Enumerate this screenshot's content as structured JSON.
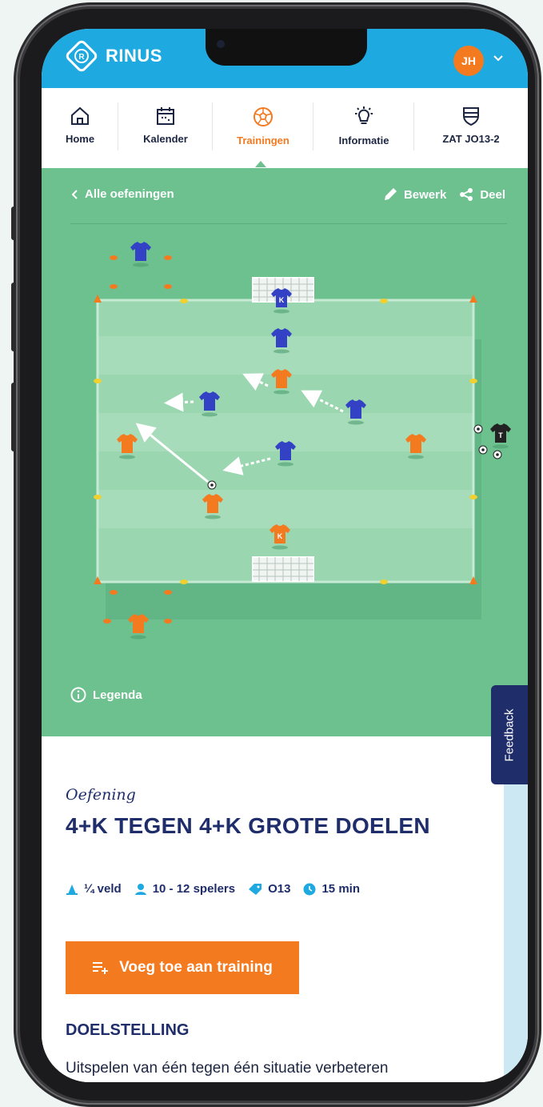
{
  "app": {
    "name": "RINUS",
    "avatar_initials": "JH"
  },
  "nav": {
    "items": [
      {
        "label": "Home",
        "icon": "home-icon"
      },
      {
        "label": "Kalender",
        "icon": "calendar-icon"
      },
      {
        "label": "Trainingen",
        "icon": "football-icon",
        "active": true
      },
      {
        "label": "Informatie",
        "icon": "lightbulb-icon"
      },
      {
        "label": "ZAT JO13-2",
        "icon": "shield-icon"
      }
    ]
  },
  "toolbar": {
    "back_label": "Alle oefeningen",
    "edit_label": "Bewerk",
    "share_label": "Deel"
  },
  "field": {
    "legend_label": "Legenda",
    "players": [
      {
        "team": "blue",
        "mark": ""
      },
      {
        "team": "blue",
        "mark": "K"
      },
      {
        "team": "blue",
        "mark": ""
      },
      {
        "team": "blue",
        "mark": ""
      },
      {
        "team": "blue",
        "mark": ""
      },
      {
        "team": "blue",
        "mark": ""
      },
      {
        "team": "orange",
        "mark": ""
      },
      {
        "team": "orange",
        "mark": ""
      },
      {
        "team": "orange",
        "mark": ""
      },
      {
        "team": "orange",
        "mark": ""
      },
      {
        "team": "orange",
        "mark": "K"
      },
      {
        "team": "orange",
        "mark": ""
      },
      {
        "team": "black",
        "mark": "T"
      }
    ],
    "colors": {
      "grass": "#6cc18f",
      "field": "#9ad6b0",
      "blue_team": "#3342c4",
      "orange_team": "#f47a20",
      "trainer": "#222222"
    }
  },
  "feedback_label": "Feedback",
  "exercise": {
    "kicker": "Oefening",
    "title": "4+K TEGEN 4+K GROTE DOELEN",
    "meta": [
      {
        "icon": "cone-icon",
        "text": "¼ veld"
      },
      {
        "icon": "person-icon",
        "text": "10 - 12 spelers"
      },
      {
        "icon": "tag-icon",
        "text": "O13"
      },
      {
        "icon": "clock-icon",
        "text": "15 min"
      }
    ],
    "add_button": "Voeg toe aan training",
    "section_title": "DOELSTELLING",
    "section_text": "Uitspelen van één tegen één situatie verbeteren"
  },
  "colors": {
    "header": "#1ea9e0",
    "accent": "#f47a20",
    "navy": "#1f2d6b"
  }
}
